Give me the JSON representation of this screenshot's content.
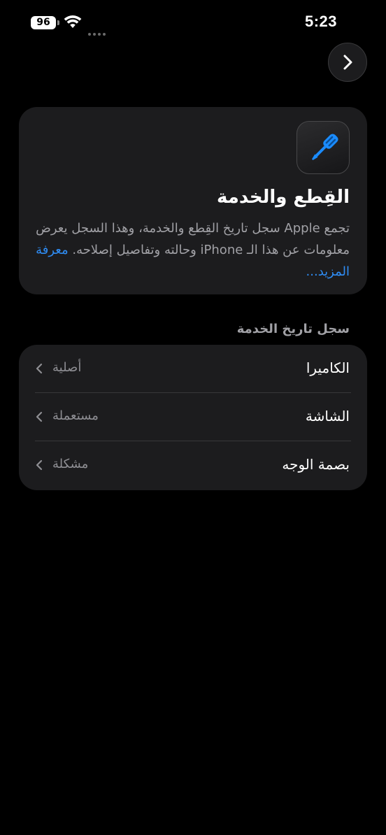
{
  "status_bar": {
    "battery_level": "96",
    "time": "5:23"
  },
  "header": {
    "title": "القِطع والخدمة",
    "description": "تجمع Apple سجل تاريخ القِطع والخدمة، وهذا السجل يعرض معلومات عن هذا الـ iPhone وحالته وتفاصيل إصلاحه.",
    "learn_more": "معرفة المزيد..."
  },
  "service_history": {
    "section_title": "سجل تاريخ الخدمة",
    "items": [
      {
        "label": "الكاميرا",
        "value": "أصلية"
      },
      {
        "label": "الشاشة",
        "value": "مستعملة"
      },
      {
        "label": "بصمة الوجه",
        "value": "مشكلة"
      }
    ]
  },
  "icons": {
    "nav": "chevron-right-icon",
    "app": "screwdriver-icon",
    "row": "chevron-left-icon"
  },
  "colors": {
    "background": "#000000",
    "card": "#1c1c1e",
    "link": "#2f8df5",
    "secondary_text": "#a1a1a6",
    "icon_accent": "#1a8cff"
  }
}
